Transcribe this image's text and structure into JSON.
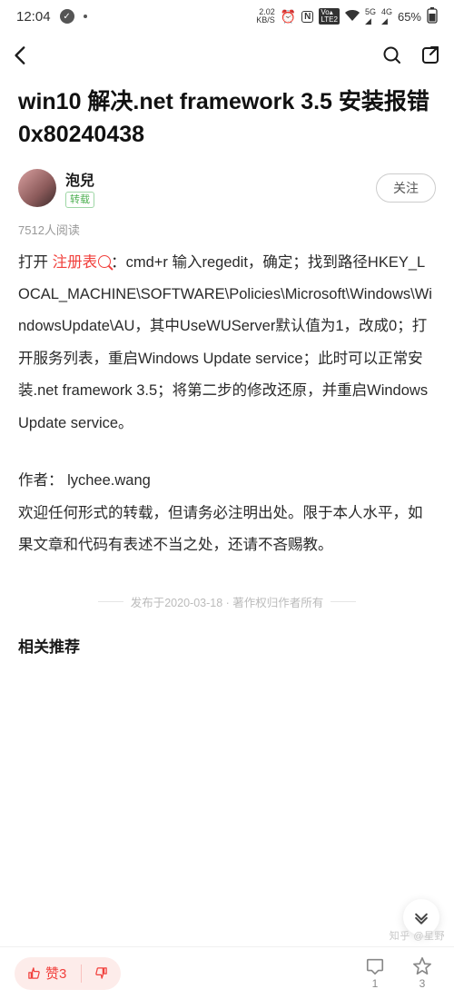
{
  "status": {
    "time": "12:04",
    "net_speed_top": "2.02",
    "net_speed_unit": "KB/S",
    "battery": "65%"
  },
  "article": {
    "title": "win10 解决.net framework 3.5 安装报错 0x80240438",
    "author_name": "泡兒",
    "repost_tag": "转载",
    "follow_label": "关注",
    "read_count": "7512人阅读",
    "body_prefix": "打开 ",
    "body_highlight": "注册表",
    "body_main": "：cmd+r 输入regedit，确定；找到路径HKEY_LOCAL_MACHINE\\SOFTWARE\\Policies\\Microsoft\\Windows\\WindowsUpdate\\AU，其中UseWUServer默认值为1，改成0；打开服务列表，重启Windows Update service；此时可以正常安装.net framework 3.5；将第二步的修改还原，并重启Windows Update service。",
    "body_author_line": "作者：  lychee.wang",
    "body_footer": "欢迎任何形式的转载，但请务必注明出处。限于本人水平，如果文章和代码有表述不当之处，还请不吝赐教。",
    "publish_line": "发布于2020-03-18 · 著作权归作者所有",
    "related_heading": "相关推荐"
  },
  "bottom": {
    "upvote_label": "赞3",
    "comment_count": "1",
    "favorite_count": "3"
  },
  "watermark": "知乎 @星野"
}
